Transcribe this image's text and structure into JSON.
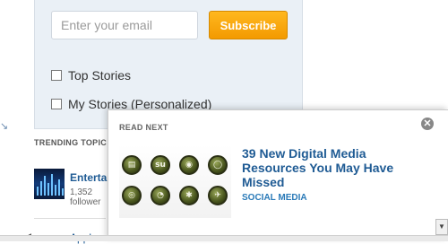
{
  "subscribe": {
    "email_placeholder": "Enter your email",
    "button_label": "Subscribe",
    "options": [
      {
        "label": "Top Stories",
        "checked": false
      },
      {
        "label": "My Stories (Personalized)",
        "checked": false
      }
    ]
  },
  "trending": {
    "heading": "TRENDING TOPIC",
    "item_title": "Entertai",
    "item_count_1": "1,352",
    "item_count_2": "follower",
    "next_item": "Apple"
  },
  "read_next": {
    "label": "READ NEXT",
    "close_glyph": "✕",
    "article_title": "39 New Digital Media Resources You May Have Missed",
    "category": "SOCIAL MEDIA",
    "icon_glyphs": [
      "▤",
      "su",
      "◉",
      "◯",
      "◎",
      "◔",
      "✱",
      "✈"
    ]
  },
  "colors": {
    "accent": "#f39a00",
    "link": "#1f5b94",
    "category": "#2a7ab8",
    "panel_bg": "#eaf0f6"
  }
}
